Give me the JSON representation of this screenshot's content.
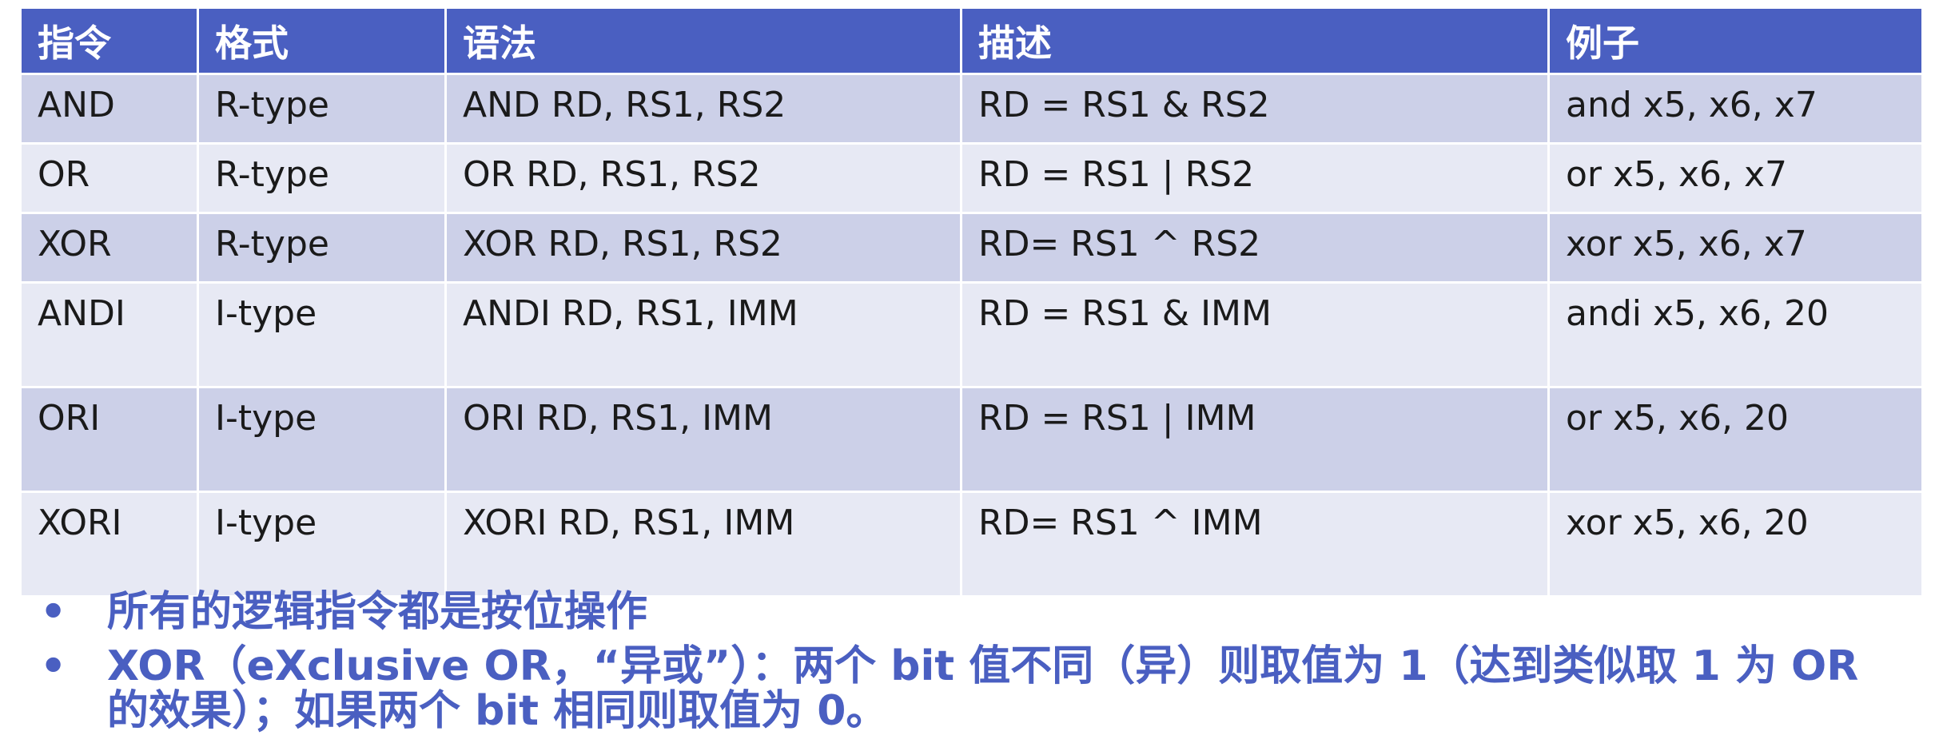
{
  "table": {
    "headers": [
      "指令",
      "格式",
      "语法",
      "描述",
      "例子"
    ],
    "rows": [
      {
        "instr": "AND",
        "format": "R-type",
        "syntax": "AND RD, RS1, RS2",
        "desc": "RD = RS1 & RS2",
        "example": "and x5, x6, x7"
      },
      {
        "instr": "OR",
        "format": "R-type",
        "syntax": "OR RD, RS1, RS2",
        "desc": "RD = RS1 | RS2",
        "example": "or x5, x6, x7"
      },
      {
        "instr": "XOR",
        "format": "R-type",
        "syntax": "XOR RD, RS1, RS2",
        "desc": "RD= RS1 ^ RS2",
        "example": "xor x5, x6, x7"
      },
      {
        "instr": "ANDI",
        "format": "I-type",
        "syntax": "ANDI RD, RS1, IMM",
        "desc": "RD = RS1 & IMM",
        "example": "andi x5, x6, 20"
      },
      {
        "instr": "ORI",
        "format": "I-type",
        "syntax": "ORI RD, RS1, IMM",
        "desc": "RD = RS1 | IMM",
        "example": "or x5, x6, 20"
      },
      {
        "instr": "XORI",
        "format": "I-type",
        "syntax": "XORI RD, RS1, IMM",
        "desc": "RD= RS1 ^ IMM",
        "example": "xor x5, x6, 20"
      }
    ]
  },
  "notes": {
    "bullet": "•",
    "items": [
      "所有的逻辑指令都是按位操作",
      "XOR（eXclusive OR，“异或”）：两个 bit 值不同（异）则取值为 1（达到类似取 1 为 OR 的效果）；如果两个 bit 相同则取值为 0。"
    ]
  },
  "colors": {
    "header_bg": "#4a5fc1",
    "row_dark": "#ccd0e8",
    "row_light": "#e7e9f4",
    "note_text": "#4a5fc1"
  }
}
